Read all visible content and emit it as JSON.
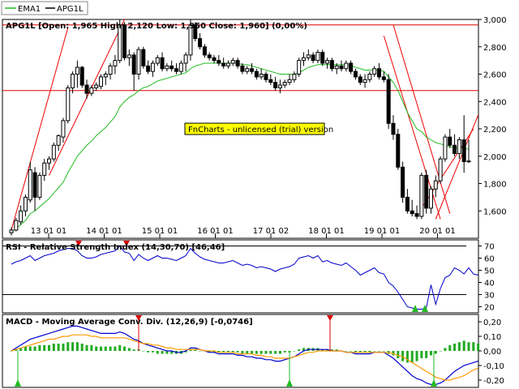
{
  "legend": [
    {
      "label": "EMA1",
      "color": "#22bb22"
    },
    {
      "label": "APG1L",
      "color": "#000000"
    }
  ],
  "watermark": "FnCharts - unlicensed (trial) version",
  "chart_data": [
    {
      "type": "candlestick",
      "title": "APG1L [Open: 1,965  High: 2,120  Low: 1,950  Close: 1,960] (0,00%)",
      "ylim": [
        1400,
        3000
      ],
      "yticks": [
        1600,
        1800,
        2000,
        2200,
        2400,
        2600,
        2800,
        3000
      ],
      "ytick_labels": [
        "1,600",
        "1,800",
        "2,000",
        "2,200",
        "2,400",
        "2,600",
        "2,800",
        "3,000"
      ],
      "xtick_labels": [
        "13 01 01",
        "14 01 01",
        "15 01 01",
        "16 01 01",
        "17 01 02",
        "18 01 01",
        "19 01 01",
        "20 01 01"
      ],
      "hlines": [
        2960,
        2480
      ],
      "grid": false,
      "candles": [
        [
          1440,
          1480,
          1420,
          1460
        ],
        [
          1460,
          1550,
          1450,
          1530
        ],
        [
          1520,
          1640,
          1500,
          1600
        ],
        [
          1600,
          1720,
          1560,
          1700
        ],
        [
          1680,
          1960,
          1660,
          1900
        ],
        [
          1880,
          1920,
          1600,
          1700
        ],
        [
          1700,
          1880,
          1680,
          1860
        ],
        [
          1860,
          1980,
          1820,
          1950
        ],
        [
          1950,
          2000,
          1900,
          1980
        ],
        [
          1980,
          2100,
          1960,
          2080
        ],
        [
          2080,
          2160,
          2040,
          2150
        ],
        [
          2140,
          2280,
          2100,
          2260
        ],
        [
          2260,
          2520,
          2240,
          2500
        ],
        [
          2500,
          2620,
          2460,
          2600
        ],
        [
          2600,
          2700,
          2500,
          2650
        ],
        [
          2650,
          2660,
          2500,
          2520
        ],
        [
          2520,
          2560,
          2420,
          2460
        ],
        [
          2460,
          2520,
          2440,
          2500
        ],
        [
          2500,
          2540,
          2480,
          2520
        ],
        [
          2510,
          2600,
          2490,
          2580
        ],
        [
          2580,
          2620,
          2520,
          2600
        ],
        [
          2600,
          2680,
          2560,
          2660
        ],
        [
          2660,
          2740,
          2600,
          2700
        ],
        [
          2700,
          3000,
          2680,
          2960
        ],
        [
          2960,
          2980,
          2700,
          2720
        ],
        [
          2720,
          2780,
          2660,
          2740
        ],
        [
          2740,
          2760,
          2480,
          2600
        ],
        [
          2600,
          2800,
          2560,
          2780
        ],
        [
          2780,
          2800,
          2640,
          2660
        ],
        [
          2660,
          2700,
          2600,
          2620
        ],
        [
          2620,
          2700,
          2580,
          2680
        ],
        [
          2680,
          2740,
          2660,
          2720
        ],
        [
          2720,
          2760,
          2620,
          2640
        ],
        [
          2640,
          2680,
          2620,
          2660
        ],
        [
          2660,
          2700,
          2620,
          2640
        ],
        [
          2640,
          2680,
          2600,
          2620
        ],
        [
          2620,
          2700,
          2600,
          2680
        ],
        [
          2680,
          2760,
          2620,
          2740
        ],
        [
          2740,
          3000,
          2700,
          2960
        ],
        [
          2960,
          2980,
          2840,
          2860
        ],
        [
          2860,
          2900,
          2780,
          2800
        ],
        [
          2800,
          2820,
          2720,
          2740
        ],
        [
          2740,
          2760,
          2700,
          2720
        ],
        [
          2720,
          2740,
          2680,
          2700
        ],
        [
          2700,
          2740,
          2660,
          2680
        ],
        [
          2680,
          2720,
          2640,
          2660
        ],
        [
          2660,
          2700,
          2640,
          2680
        ],
        [
          2680,
          2720,
          2660,
          2700
        ],
        [
          2700,
          2720,
          2640,
          2660
        ],
        [
          2660,
          2680,
          2600,
          2620
        ],
        [
          2620,
          2660,
          2600,
          2640
        ],
        [
          2640,
          2680,
          2600,
          2620
        ],
        [
          2620,
          2640,
          2560,
          2580
        ],
        [
          2580,
          2640,
          2560,
          2600
        ],
        [
          2600,
          2620,
          2540,
          2560
        ],
        [
          2560,
          2600,
          2520,
          2540
        ],
        [
          2540,
          2580,
          2480,
          2500
        ],
        [
          2500,
          2560,
          2460,
          2520
        ],
        [
          2520,
          2560,
          2500,
          2540
        ],
        [
          2540,
          2600,
          2520,
          2560
        ],
        [
          2560,
          2620,
          2540,
          2600
        ],
        [
          2600,
          2720,
          2580,
          2700
        ],
        [
          2700,
          2760,
          2660,
          2720
        ],
        [
          2720,
          2780,
          2700,
          2740
        ],
        [
          2740,
          2760,
          2680,
          2700
        ],
        [
          2700,
          2780,
          2680,
          2760
        ],
        [
          2760,
          2780,
          2660,
          2680
        ],
        [
          2680,
          2720,
          2640,
          2700
        ],
        [
          2700,
          2720,
          2620,
          2640
        ],
        [
          2640,
          2680,
          2600,
          2660
        ],
        [
          2660,
          2700,
          2620,
          2640
        ],
        [
          2640,
          2700,
          2620,
          2680
        ],
        [
          2680,
          2700,
          2600,
          2620
        ],
        [
          2620,
          2640,
          2560,
          2580
        ],
        [
          2580,
          2600,
          2520,
          2540
        ],
        [
          2540,
          2600,
          2500,
          2560
        ],
        [
          2560,
          2620,
          2540,
          2600
        ],
        [
          2600,
          2660,
          2580,
          2640
        ],
        [
          2640,
          2680,
          2560,
          2580
        ],
        [
          2580,
          2620,
          2540,
          2560
        ],
        [
          2560,
          2600,
          2200,
          2240
        ],
        [
          2240,
          2300,
          2120,
          2160
        ],
        [
          2160,
          2200,
          1900,
          1920
        ],
        [
          1920,
          1960,
          1660,
          1700
        ],
        [
          1700,
          1760,
          1580,
          1600
        ],
        [
          1600,
          1680,
          1560,
          1580
        ],
        [
          1580,
          1640,
          1540,
          1560
        ],
        [
          1560,
          1880,
          1540,
          1860
        ],
        [
          1860,
          1900,
          1580,
          1620
        ],
        [
          1620,
          1780,
          1580,
          1760
        ],
        [
          1760,
          1860,
          1700,
          1820
        ],
        [
          1820,
          2000,
          1800,
          1980
        ],
        [
          1980,
          2160,
          1960,
          2140
        ],
        [
          2140,
          2200,
          2060,
          2080
        ],
        [
          2080,
          2160,
          2000,
          2020
        ],
        [
          2020,
          2140,
          1980,
          2120
        ],
        [
          2120,
          2300,
          1880,
          1960
        ],
        [
          1965,
          2120,
          1950,
          1960
        ]
      ],
      "series": [
        {
          "name": "EMA1",
          "color": "#22bb22",
          "values": [
            1450,
            1470,
            1500,
            1530,
            1580,
            1600,
            1630,
            1660,
            1690,
            1730,
            1770,
            1810,
            1880,
            1940,
            2000,
            2040,
            2080,
            2110,
            2150,
            2180,
            2210,
            2250,
            2290,
            2360,
            2400,
            2430,
            2450,
            2480,
            2500,
            2510,
            2530,
            2550,
            2560,
            2570,
            2580,
            2590,
            2600,
            2610,
            2640,
            2660,
            2670,
            2680,
            2680,
            2680,
            2680,
            2680,
            2680,
            2680,
            2680,
            2670,
            2670,
            2660,
            2650,
            2640,
            2630,
            2620,
            2610,
            2600,
            2600,
            2600,
            2600,
            2610,
            2630,
            2650,
            2660,
            2670,
            2670,
            2670,
            2670,
            2670,
            2670,
            2670,
            2660,
            2650,
            2640,
            2630,
            2630,
            2630,
            2630,
            2620,
            2580,
            2540,
            2480,
            2400,
            2320,
            2260,
            2200,
            2180,
            2140,
            2120,
            2100,
            2090,
            2080,
            2070,
            2060,
            2060,
            2060,
            2050
          ]
        }
      ],
      "trendlines": [
        {
          "from": [
            0,
            1460
          ],
          "to": [
            12,
            2940
          ]
        },
        {
          "from": [
            8,
            1860
          ],
          "to": [
            24,
            3000
          ]
        },
        {
          "from": [
            79,
            2880
          ],
          "to": [
            91,
            1540
          ]
        },
        {
          "from": [
            81,
            2960
          ],
          "to": [
            93,
            1580
          ]
        },
        {
          "from": [
            87,
            1620
          ],
          "to": [
            98,
            2200
          ]
        },
        {
          "from": [
            90,
            1540
          ],
          "to": [
            99,
            2300
          ]
        }
      ]
    },
    {
      "type": "line",
      "title": "RSI - Relative Strength Index (14,30,70) [46,46]",
      "ylim": [
        15,
        75
      ],
      "yticks": [
        20,
        30,
        40,
        50,
        60,
        70
      ],
      "ytick_labels": [
        "20",
        "30",
        "40",
        "50",
        "60",
        "70"
      ],
      "hlines": [
        70,
        30
      ],
      "series": [
        {
          "name": "RSI",
          "color": "#0000cc",
          "values": [
            55,
            57,
            58,
            60,
            62,
            58,
            60,
            62,
            63,
            64,
            66,
            67,
            68,
            68,
            66,
            62,
            60,
            60,
            61,
            63,
            64,
            65,
            66,
            70,
            65,
            64,
            58,
            63,
            60,
            58,
            60,
            62,
            60,
            60,
            59,
            58,
            60,
            62,
            68,
            64,
            61,
            59,
            58,
            57,
            56,
            56,
            57,
            58,
            56,
            54,
            55,
            54,
            52,
            53,
            52,
            51,
            49,
            51,
            52,
            53,
            55,
            60,
            61,
            62,
            60,
            62,
            57,
            58,
            56,
            55,
            54,
            56,
            53,
            50,
            46,
            48,
            50,
            52,
            48,
            47,
            40,
            37,
            32,
            26,
            20,
            19,
            18,
            18,
            19,
            38,
            22,
            35,
            44,
            46,
            52,
            50,
            47,
            52,
            47,
            46
          ]
        }
      ]
    },
    {
      "type": "bar+line",
      "title": "MACD - Moving Average Conv. Div. (12,26,9) [-0,0746]",
      "ylim": [
        -0.25,
        0.25
      ],
      "yticks": [
        0.2,
        0.1,
        0.0,
        -0.1,
        -0.2
      ],
      "ytick_labels": [
        "0,20",
        "0,10",
        "0,00",
        "-0,10",
        "-0,20"
      ],
      "histogram": [
        0,
        0.01,
        0.02,
        0.03,
        0.03,
        0.03,
        0.04,
        0.04,
        0.04,
        0.05,
        0.05,
        0.05,
        0.06,
        0.06,
        0.06,
        0.05,
        0.04,
        0.04,
        0.03,
        0.03,
        0.03,
        0.03,
        0.03,
        0.04,
        0.03,
        0.02,
        0.01,
        0.01,
        0,
        -0.01,
        -0.01,
        -0.02,
        -0.02,
        -0.02,
        -0.02,
        -0.02,
        -0.02,
        -0.01,
        0.01,
        0.01,
        0,
        0,
        -0.01,
        -0.01,
        -0.01,
        -0.01,
        -0.01,
        -0.01,
        -0.01,
        -0.02,
        -0.02,
        -0.02,
        -0.02,
        -0.02,
        -0.02,
        -0.02,
        -0.02,
        -0.02,
        -0.01,
        -0.01,
        0,
        0.01,
        0.02,
        0.02,
        0.02,
        0.02,
        0.01,
        0.01,
        0.01,
        0.01,
        0,
        0,
        0,
        -0.01,
        -0.01,
        -0.01,
        -0.01,
        0,
        0,
        0,
        -0.02,
        -0.03,
        -0.05,
        -0.07,
        -0.08,
        -0.08,
        -0.07,
        -0.05,
        -0.05,
        -0.03,
        -0.02,
        0,
        0.02,
        0.04,
        0.05,
        0.06,
        0.07,
        0.06,
        0.06,
        0.05
      ],
      "series": [
        {
          "name": "MACD",
          "color": "#0000cc",
          "values": [
            0,
            0.02,
            0.04,
            0.06,
            0.08,
            0.09,
            0.1,
            0.11,
            0.12,
            0.13,
            0.14,
            0.15,
            0.16,
            0.17,
            0.17,
            0.16,
            0.15,
            0.14,
            0.13,
            0.12,
            0.12,
            0.12,
            0.12,
            0.13,
            0.12,
            0.1,
            0.08,
            0.07,
            0.05,
            0.04,
            0.03,
            0.02,
            0.01,
            0,
            0,
            -0.01,
            -0.01,
            0,
            0.02,
            0.02,
            0.01,
            0,
            -0.01,
            -0.01,
            -0.02,
            -0.02,
            -0.02,
            -0.02,
            -0.03,
            -0.03,
            -0.04,
            -0.04,
            -0.05,
            -0.05,
            -0.06,
            -0.06,
            -0.07,
            -0.07,
            -0.06,
            -0.05,
            -0.04,
            -0.02,
            0,
            0.01,
            0.01,
            0.01,
            0.01,
            0.01,
            0,
            0,
            0,
            -0.01,
            -0.01,
            -0.02,
            -0.02,
            -0.02,
            -0.02,
            -0.01,
            -0.01,
            -0.01,
            -0.03,
            -0.05,
            -0.08,
            -0.11,
            -0.14,
            -0.17,
            -0.19,
            -0.2,
            -0.22,
            -0.23,
            -0.23,
            -0.22,
            -0.2,
            -0.17,
            -0.14,
            -0.12,
            -0.1,
            -0.09,
            -0.08,
            -0.07
          ]
        },
        {
          "name": "Signal",
          "color": "#ff9900",
          "values": [
            0,
            0.01,
            0.02,
            0.03,
            0.04,
            0.05,
            0.06,
            0.07,
            0.08,
            0.08,
            0.09,
            0.1,
            0.1,
            0.11,
            0.11,
            0.11,
            0.11,
            0.1,
            0.1,
            0.09,
            0.09,
            0.09,
            0.09,
            0.09,
            0.09,
            0.08,
            0.07,
            0.06,
            0.05,
            0.05,
            0.04,
            0.04,
            0.03,
            0.02,
            0.02,
            0.01,
            0.01,
            0.01,
            0.01,
            0.01,
            0.01,
            0,
            0,
            0,
            -0.01,
            -0.01,
            -0.01,
            -0.01,
            -0.02,
            -0.02,
            -0.02,
            -0.02,
            -0.03,
            -0.03,
            -0.04,
            -0.04,
            -0.05,
            -0.05,
            -0.05,
            -0.05,
            -0.04,
            -0.03,
            -0.02,
            -0.01,
            -0.01,
            0,
            0,
            0,
            0,
            0,
            0,
            -0.01,
            -0.01,
            -0.01,
            -0.01,
            -0.01,
            -0.01,
            -0.01,
            -0.01,
            -0.01,
            -0.01,
            -0.02,
            -0.03,
            -0.04,
            -0.06,
            -0.08,
            -0.1,
            -0.12,
            -0.14,
            -0.16,
            -0.18,
            -0.19,
            -0.2,
            -0.2,
            -0.19,
            -0.18,
            -0.17,
            -0.15,
            -0.13,
            -0.12
          ]
        }
      ]
    }
  ]
}
